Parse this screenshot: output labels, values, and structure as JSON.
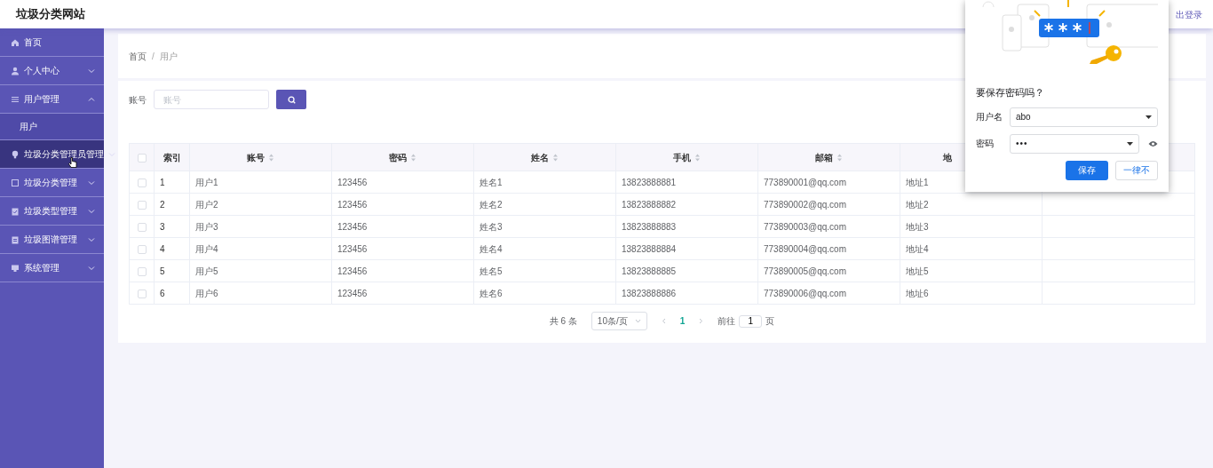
{
  "header": {
    "title": "垃圾分类网站",
    "logout": "出登录"
  },
  "sidebar": {
    "items": [
      {
        "label": "首页",
        "kind": "link",
        "selected": false
      },
      {
        "label": "个人中心",
        "kind": "menu",
        "expanded": false,
        "selected": false
      },
      {
        "label": "用户管理",
        "kind": "menu",
        "expanded": true,
        "selected": false,
        "children": [
          {
            "label": "用户"
          }
        ]
      },
      {
        "label": "垃圾分类管理员管理",
        "kind": "menu",
        "expanded": false,
        "selected": true
      },
      {
        "label": "垃圾分类管理",
        "kind": "menu",
        "expanded": false,
        "selected": false
      },
      {
        "label": "垃圾类型管理",
        "kind": "menu",
        "expanded": false,
        "selected": false
      },
      {
        "label": "垃圾图谱管理",
        "kind": "menu",
        "expanded": false,
        "selected": false
      },
      {
        "label": "系统管理",
        "kind": "menu",
        "expanded": false,
        "selected": false
      }
    ]
  },
  "breadcrumb": [
    "首页",
    "用户"
  ],
  "breadcrumb_separator": "/",
  "search": {
    "label": "账号",
    "placeholder": "账号"
  },
  "table": {
    "header_checked": false,
    "columns": [
      {
        "label": "索引",
        "sortable": false
      },
      {
        "label": "账号",
        "sortable": true
      },
      {
        "label": "密码",
        "sortable": true
      },
      {
        "label": "姓名",
        "sortable": true
      },
      {
        "label": "手机",
        "sortable": true
      },
      {
        "label": "邮箱",
        "sortable": true
      },
      {
        "label": "地",
        "sortable": false
      }
    ],
    "rows": [
      {
        "checked": false,
        "cells": [
          "1",
          "用户1",
          "123456",
          "姓名1",
          "13823888881",
          "773890001@qq.com",
          "地址1"
        ]
      },
      {
        "checked": false,
        "cells": [
          "2",
          "用户2",
          "123456",
          "姓名2",
          "13823888882",
          "773890002@qq.com",
          "地址2"
        ]
      },
      {
        "checked": false,
        "cells": [
          "3",
          "用户3",
          "123456",
          "姓名3",
          "13823888883",
          "773890003@qq.com",
          "地址3"
        ]
      },
      {
        "checked": false,
        "cells": [
          "4",
          "用户4",
          "123456",
          "姓名4",
          "13823888884",
          "773890004@qq.com",
          "地址4"
        ]
      },
      {
        "checked": false,
        "cells": [
          "5",
          "用户5",
          "123456",
          "姓名5",
          "13823888885",
          "773890005@qq.com",
          "地址5"
        ]
      },
      {
        "checked": false,
        "cells": [
          "6",
          "用户6",
          "123456",
          "姓名6",
          "13823888886",
          "773890006@qq.com",
          "地址6"
        ]
      }
    ]
  },
  "pagination": {
    "total": "共 6 条",
    "page_size": "10条/页",
    "pages": [
      {
        "label": "1",
        "selected": true
      }
    ],
    "goto_label": "前往",
    "goto_value": "1",
    "goto_unit": "页"
  },
  "password_popup": {
    "title": "要保存密码吗？",
    "fields": [
      {
        "label": "用户名",
        "value": "abo",
        "kind": "text"
      },
      {
        "label": "密码",
        "value": "•••",
        "kind": "password"
      }
    ],
    "save": "保存",
    "never": "一律不"
  }
}
